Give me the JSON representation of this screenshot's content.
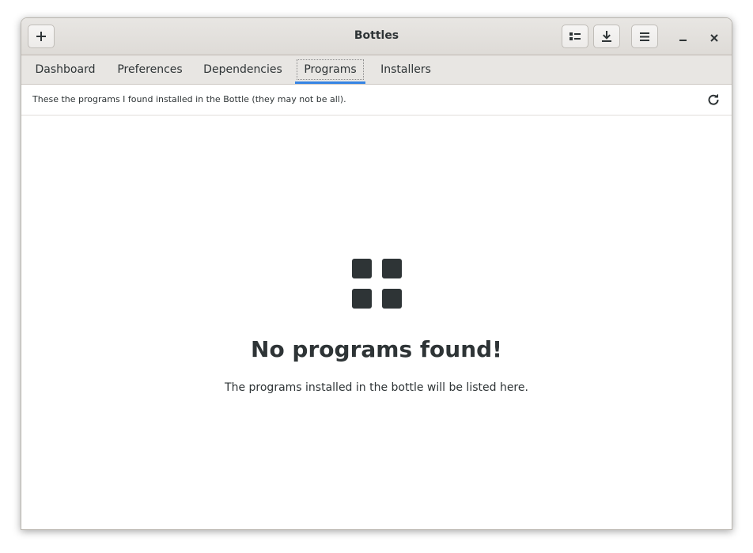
{
  "window": {
    "title": "Bottles"
  },
  "headerbar": {
    "add_icon": "plus-icon",
    "list_icon": "list-view-icon",
    "download_icon": "download-icon",
    "menu_icon": "hamburger-menu-icon",
    "minimize_icon": "minimize-icon",
    "close_icon": "close-icon"
  },
  "tabs": [
    {
      "label": "Dashboard",
      "active": false
    },
    {
      "label": "Preferences",
      "active": false
    },
    {
      "label": "Dependencies",
      "active": false
    },
    {
      "label": "Programs",
      "active": true
    },
    {
      "label": "Installers",
      "active": false
    }
  ],
  "infobar": {
    "text": "These the programs I found installed in the Bottle (they may not be all).",
    "refresh_icon": "refresh-icon"
  },
  "empty_state": {
    "icon": "grid-apps-icon",
    "title": "No programs found!",
    "description": "The programs installed in the bottle will be listed here."
  },
  "colors": {
    "accent": "#3584e4",
    "text": "#2e3436",
    "headerbar": "#e8e6e3"
  }
}
